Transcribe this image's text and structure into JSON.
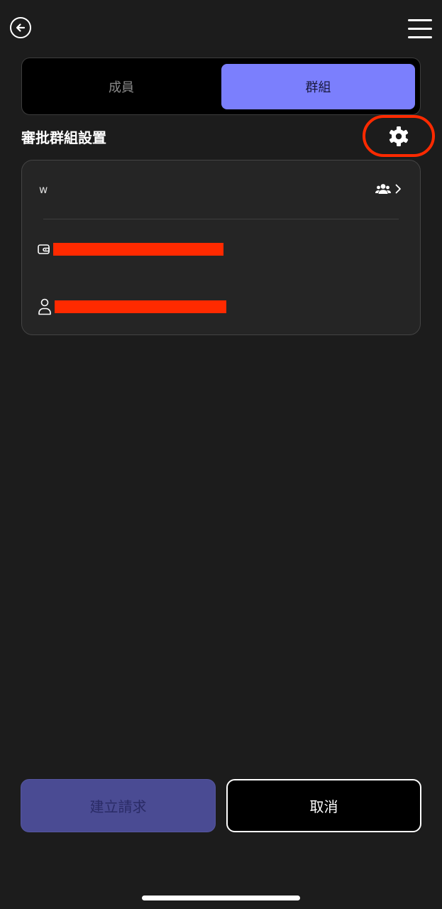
{
  "header": {
    "back_icon": "arrow-left-circle-icon",
    "menu_icon": "hamburger-menu-icon"
  },
  "tabs": {
    "members": "成員",
    "groups": "群組",
    "active": "groups"
  },
  "section": {
    "title": "審批群組設置",
    "settings_icon": "gear-icon"
  },
  "group_card": {
    "name": "w",
    "members_icon": "users-icon",
    "wallet_icon": "wallet-icon",
    "user_icon": "user-icon"
  },
  "actions": {
    "create_label": "建立請求",
    "cancel_label": "取消"
  },
  "colors": {
    "background": "#1c1c1c",
    "accent": "#7b7ffd",
    "highlight": "#ff2a00"
  }
}
